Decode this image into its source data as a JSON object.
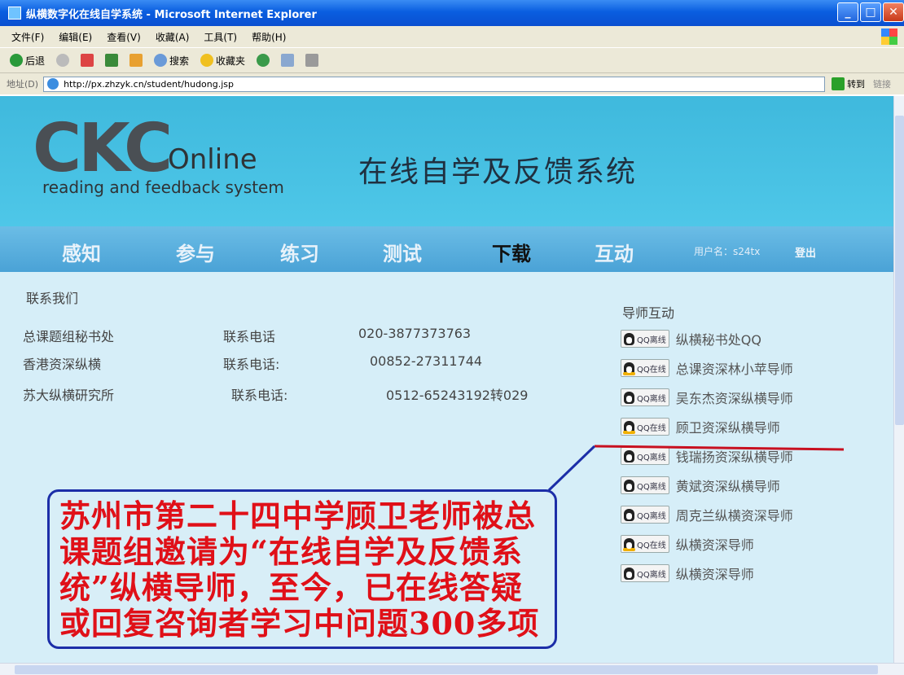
{
  "window": {
    "title": "纵横数字化在线自学系统 - Microsoft Internet Explorer",
    "buttons": {
      "minimize": "_",
      "maximize": "□",
      "close": "✕"
    }
  },
  "menubar": [
    "文件(F)",
    "编辑(E)",
    "查看(V)",
    "收藏(A)",
    "工具(T)",
    "帮助(H)"
  ],
  "toolbar": {
    "back": "后退",
    "search": "搜索",
    "favorites": "收藏夹"
  },
  "address": {
    "label": "地址(D)",
    "url": "http://px.zhzyk.cn/student/hudong.jsp",
    "go": "转到",
    "links": "链接"
  },
  "header": {
    "logo_main": "CKC",
    "logo_online": "Online",
    "logo_sub": "reading and feedback system",
    "site_title": "在线自学及反馈系统"
  },
  "nav": {
    "items": [
      "感知",
      "参与",
      "练习",
      "测试",
      "下载",
      "互动"
    ],
    "active_index": 4,
    "user": "用户名：s24tx",
    "logout": "登出"
  },
  "contact": {
    "title": "联系我们",
    "rows": [
      {
        "org": "总课题组秘书处",
        "label": "联系电话",
        "phone": "020-3877373763"
      },
      {
        "org": "香港资深纵横",
        "label": "联系电话:",
        "phone": "00852-27311744"
      },
      {
        "org": "苏大纵横研究所",
        "label": "联系电话:",
        "phone": "0512-65243192转029"
      }
    ]
  },
  "tutors": {
    "title": "导师互动",
    "items": [
      {
        "status": "QQ离线",
        "name": "纵横秘书处QQ",
        "online": false
      },
      {
        "status": "QQ在线",
        "name": "总课资深林小苹导师",
        "online": true
      },
      {
        "status": "QQ离线",
        "name": "吴东杰资深纵横导师",
        "online": false
      },
      {
        "status": "QQ在线",
        "name": "顾卫资深纵横导师",
        "online": true
      },
      {
        "status": "QQ离线",
        "name": "钱瑞扬资深纵横导师",
        "online": false
      },
      {
        "status": "QQ离线",
        "name": "黄斌资深纵横导师",
        "online": false
      },
      {
        "status": "QQ离线",
        "name": "周克兰纵横资深导师",
        "online": false
      },
      {
        "status": "QQ在线",
        "name": "纵横资深导师",
        "online": true
      },
      {
        "status": "QQ离线",
        "name": "纵横资深导师",
        "online": false
      }
    ]
  },
  "callout": {
    "lines": [
      "苏州市第二十四中学顾卫老师被总",
      "课题组邀请为“在线自学及反馈系",
      "统”纵横导师，至今，已在线答疑",
      "或回复咨询者学习中问题300多项"
    ],
    "color": "#e01018",
    "border_color": "#1c2ea8",
    "underline_color": "#c81020"
  }
}
